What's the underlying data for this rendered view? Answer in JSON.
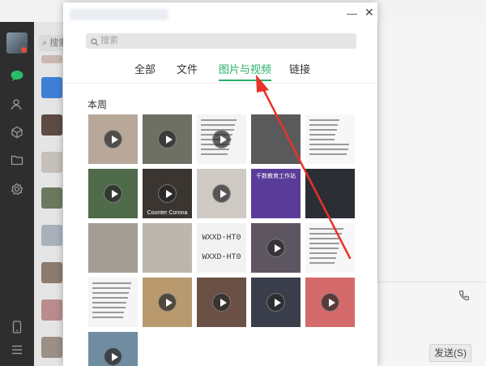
{
  "background_app": {
    "chat_search_placeholder": "搜索",
    "send_button": "发送(S)",
    "more_icon": "more-dots-icon",
    "pin_icon": "pin-icon"
  },
  "dialog": {
    "search_placeholder": "搜索",
    "tabs": [
      {
        "label": "全部",
        "active": false
      },
      {
        "label": "文件",
        "active": false
      },
      {
        "label": "图片与视频",
        "active": true
      },
      {
        "label": "链接",
        "active": false
      }
    ],
    "section_title": "本周",
    "tiles": [
      {
        "type": "video",
        "kind": "photo",
        "bg": "#b8a89a"
      },
      {
        "type": "video",
        "kind": "photo",
        "bg": "#6e7064"
      },
      {
        "type": "video",
        "kind": "text",
        "bg": "#f4f4f4"
      },
      {
        "type": "image",
        "kind": "photo",
        "bg": "#5a5a5a"
      },
      {
        "type": "image",
        "kind": "text",
        "bg": "#f7f7f7"
      },
      {
        "type": "video",
        "kind": "photo",
        "bg": "#4f6b4a"
      },
      {
        "type": "video",
        "kind": "photo",
        "bg": "#3a3530",
        "caption": "Counter Corona"
      },
      {
        "type": "video",
        "kind": "photo",
        "bg": "#cfcbc4"
      },
      {
        "type": "image",
        "kind": "banner",
        "bg": "#5a3d9a",
        "banner": "千数教育工作站"
      },
      {
        "type": "image",
        "kind": "photo",
        "bg": "#2b2e35"
      },
      {
        "type": "image",
        "kind": "photo",
        "bg": "#a39d96"
      },
      {
        "type": "image",
        "kind": "photo",
        "bg": "#bcb7ae"
      },
      {
        "type": "image",
        "kind": "code",
        "bg": "#f2f2f2",
        "code": "WXXD-HT0"
      },
      {
        "type": "video",
        "kind": "photo",
        "bg": "#5d5560"
      },
      {
        "type": "image",
        "kind": "text",
        "bg": "#f7f7f7"
      },
      {
        "type": "image",
        "kind": "text",
        "bg": "#f5f5f5"
      },
      {
        "type": "video",
        "kind": "photo",
        "bg": "#b89a6e"
      },
      {
        "type": "video",
        "kind": "photo",
        "bg": "#6a5045"
      },
      {
        "type": "video",
        "kind": "photo",
        "bg": "#3a3d4a"
      },
      {
        "type": "video",
        "kind": "photo",
        "bg": "#d46a6a"
      },
      {
        "type": "video",
        "kind": "photo",
        "bg": "#6f8ca0"
      }
    ]
  }
}
